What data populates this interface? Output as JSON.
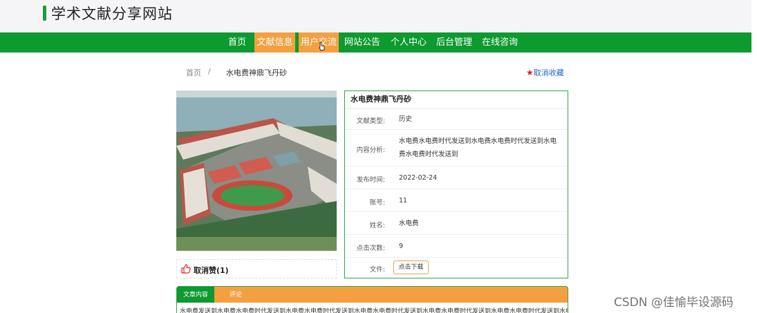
{
  "header": {
    "site_title": "学术文献分享网站"
  },
  "nav": {
    "items": [
      {
        "label": "首页"
      },
      {
        "label": "文献信息"
      },
      {
        "label": "用户交流"
      },
      {
        "label": "网站公告"
      },
      {
        "label": "个人中心"
      },
      {
        "label": "后台管理"
      },
      {
        "label": "在线咨询"
      }
    ]
  },
  "breadcrumb": {
    "home": "首页",
    "separator": "/",
    "current": "水电费神鼎飞丹砂"
  },
  "favorite": {
    "star": "★",
    "label": "取消收藏"
  },
  "like": {
    "label": "取消赞(1)",
    "icon": "thumbs-up-icon"
  },
  "detail": {
    "title": "水电费神鼎飞丹砂",
    "rows": [
      {
        "label": "文献类型:",
        "value": "历史"
      },
      {
        "label": "内容分析:",
        "value": "水电费水电费时代发送到水电费水电费时代发送到水电费水电费时代发送到"
      },
      {
        "label": "发布时间:",
        "value": "2022-02-24"
      },
      {
        "label": "账号:",
        "value": "11"
      },
      {
        "label": "姓名:",
        "value": "水电费"
      },
      {
        "label": "点击次数:",
        "value": "9"
      }
    ],
    "file_label": "文件:",
    "download_label": "点击下载"
  },
  "tabs": [
    {
      "label": "文章内容"
    },
    {
      "label": "评论"
    }
  ],
  "content": {
    "text": "水电费发送到水电费水电费时代发送到水电费水电费时代发送到水电费水电费时代发送到水电费水电费时代发送到水电费水电费时代发送到水电费水电费时代发送到水电费水电费"
  },
  "watermark": "CSDN @佳愉毕设源码",
  "colors": {
    "nav_green": "#0d9a2e",
    "nav_active": "#f5a040",
    "star": "#e0201c",
    "link": "#2266cc"
  }
}
